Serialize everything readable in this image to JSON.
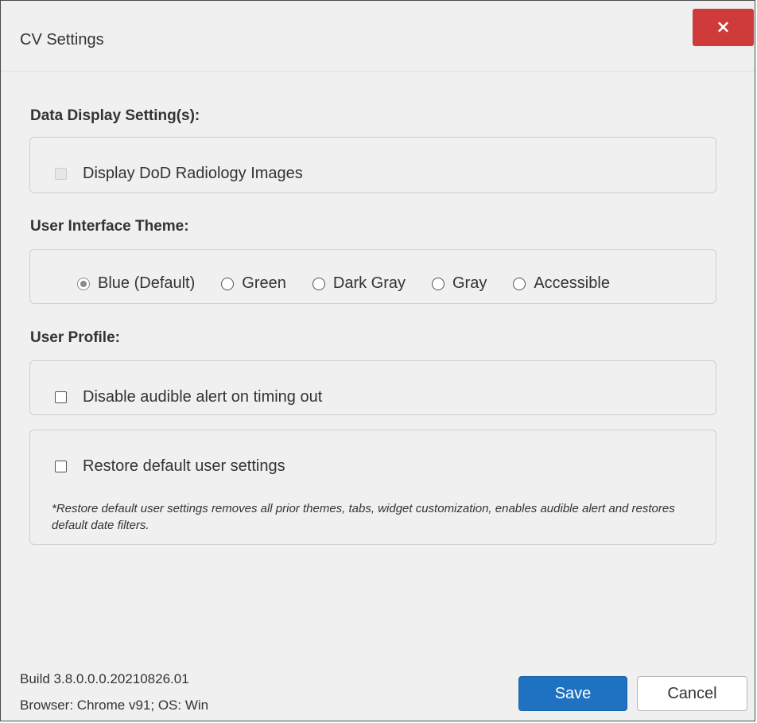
{
  "dialog": {
    "title": "CV Settings",
    "close_label": "×"
  },
  "sections": {
    "data_display": {
      "heading": "Data Display Setting(s):",
      "dod_radiology_label": "Display DoD Radiology Images",
      "dod_radiology_checked": false,
      "dod_radiology_disabled": true
    },
    "theme": {
      "heading": "User Interface Theme:",
      "options": [
        {
          "label": "Blue (Default)",
          "checked": true
        },
        {
          "label": "Green",
          "checked": false
        },
        {
          "label": "Dark Gray",
          "checked": false
        },
        {
          "label": "Gray",
          "checked": false
        },
        {
          "label": "Accessible",
          "checked": false
        }
      ]
    },
    "user_profile": {
      "heading": "User Profile:",
      "audible_alert_label": "Disable audible alert on timing out",
      "audible_alert_checked": false,
      "restore_label": "Restore default user settings",
      "restore_checked": false,
      "restore_note": "*Restore default user settings removes all prior themes, tabs, widget customization, enables audible alert and restores default date filters."
    }
  },
  "footer": {
    "build": "Build 3.8.0.0.0.20210826.01",
    "browser": "Browser: Chrome v91; OS: Win",
    "save_label": "Save",
    "cancel_label": "Cancel"
  },
  "colors": {
    "close_button": "#cf3b3b",
    "save_button": "#1f72c1",
    "dialog_background": "#f0f0f0"
  },
  "icons": {
    "close": "close-icon"
  }
}
